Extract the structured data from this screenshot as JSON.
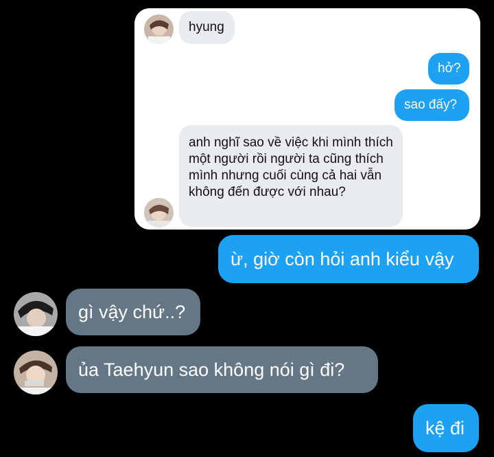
{
  "inner_chat": {
    "messages": [
      {
        "sender": "other",
        "text": "hyung"
      },
      {
        "sender": "me",
        "text": "hở?"
      },
      {
        "sender": "me",
        "text": "sao đấy?"
      },
      {
        "sender": "other",
        "text": "anh nghĩ sao về việc khi mình thích một người rồi người ta cũng thích mình nhưng cuối cùng cả hai vẫn không đến được với nhau?"
      }
    ]
  },
  "outer_chat": {
    "messages": [
      {
        "sender": "me",
        "text": "ừ, giờ còn hỏi anh kiểu vậy"
      },
      {
        "sender": "other",
        "text": "gì vậy chứ..?"
      },
      {
        "sender": "other",
        "text": "ủa Taehyun sao không nói gì đi?"
      },
      {
        "sender": "me",
        "text": "kệ đi"
      }
    ]
  },
  "colors": {
    "background": "#000000",
    "outgoing_bubble": "#1da1f2",
    "incoming_bubble_light": "#e8ebef",
    "incoming_bubble_dark": "#657786"
  }
}
